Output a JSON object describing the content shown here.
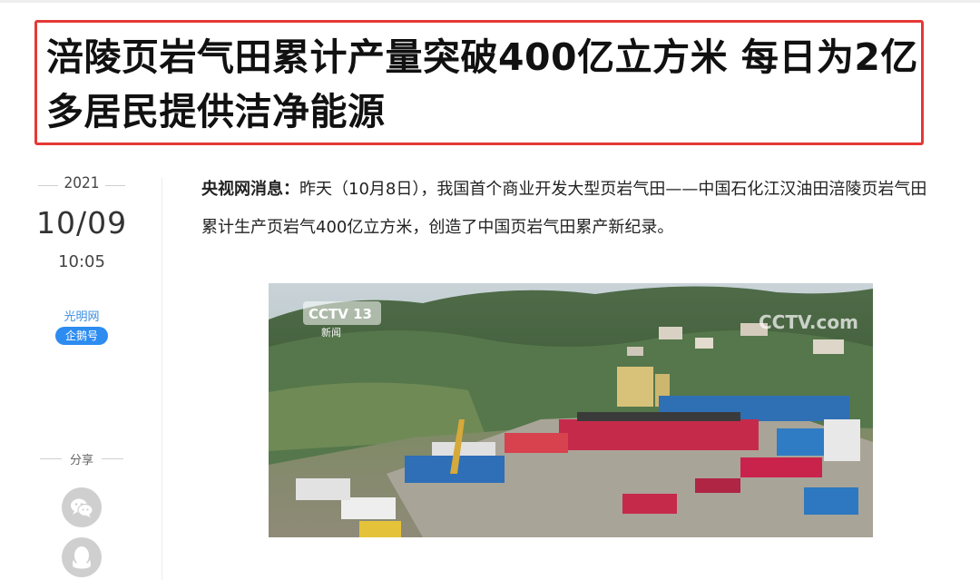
{
  "headline": "涪陵页岩气田累计产量突破400亿立方米 每日为2亿多居民提供洁净能源",
  "meta": {
    "year": "2021",
    "date": "10/09",
    "time": "10:05",
    "source": "光明网",
    "badge": "企鹅号",
    "share_label": "分享"
  },
  "article": {
    "lead_source": "央视网消息：",
    "lead_text": "昨天（10月8日），我国首个商业开发大型页岩气田——中国石化江汉油田涪陵页岩气田累计生产页岩气400亿立方米，创造了中国页岩气田累产新纪录。"
  },
  "photo": {
    "channel_logo": "CCTV 13",
    "channel_sub": "新闻",
    "watermark": "CCTV.com"
  },
  "colors": {
    "highlight_box": "#e53935",
    "badge_bg": "#2d8cf0",
    "source_link": "#3a8de0",
    "share_button": "#cfcfcf"
  },
  "icons": [
    "wechat-icon",
    "qq-icon"
  ]
}
